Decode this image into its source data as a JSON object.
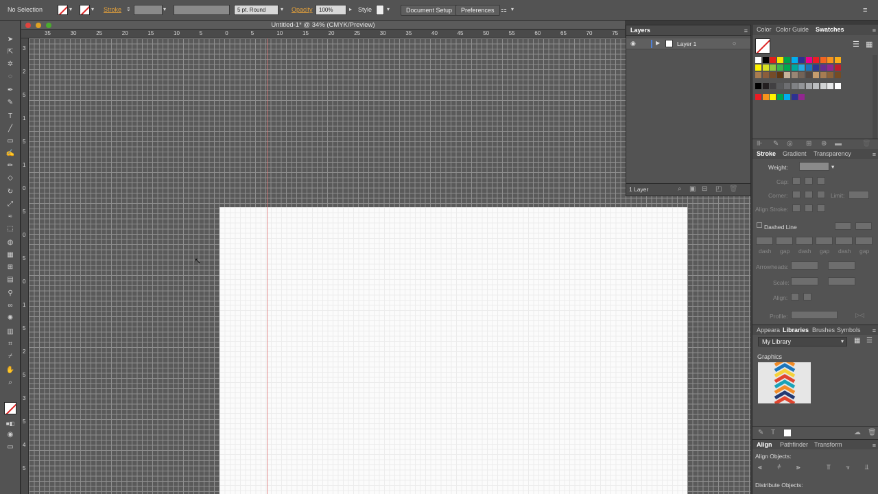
{
  "control_bar": {
    "selection": "No Selection",
    "stroke_label": "Stroke",
    "brush": "5 pt. Round",
    "opacity_label": "Opacity",
    "opacity_value": "100%",
    "style_label": "Style",
    "doc_setup": "Document Setup",
    "preferences": "Preferences"
  },
  "document": {
    "title": "Untitled-1* @ 34% (CMYK/Preview)",
    "ruler_ticks": [
      "35",
      "30",
      "25",
      "20",
      "15",
      "10",
      "5",
      "0",
      "5",
      "10",
      "15",
      "20",
      "25",
      "30",
      "35",
      "40",
      "45",
      "50",
      "55",
      "60",
      "65",
      "70",
      "75"
    ],
    "vruler_ticks": [
      "3",
      "2",
      "5",
      "1",
      "5",
      "1",
      "0",
      "5",
      "0",
      "5",
      "0",
      "1",
      "5",
      "2",
      "5",
      "3",
      "5",
      "4",
      "5"
    ]
  },
  "layers": {
    "tab": "Layers",
    "layer_name": "Layer 1",
    "count": "1 Layer"
  },
  "swatches": {
    "tabs": [
      "Color",
      "Color Guide",
      "Swatches"
    ],
    "row1": [
      "#ffffff",
      "#000000",
      "#e0201b",
      "#f5e500",
      "#00a14b",
      "#00aeef",
      "#2e3192",
      "#ec008c",
      "#ed1c24",
      "#f26522",
      "#f7941d",
      "#f9ad19"
    ],
    "row2": [
      "#fff200",
      "#d7df23",
      "#8dc63f",
      "#39b54a",
      "#00a651",
      "#00a99d",
      "#27aae1",
      "#1c75bc",
      "#2b3990",
      "#662d91",
      "#92278f",
      "#be1e2d"
    ],
    "row3": [
      "#a97c50",
      "#8b5e3c",
      "#754c29",
      "#603913",
      "#c7b299",
      "#998675",
      "#736357",
      "#534741",
      "#c69c6d",
      "#a67c52",
      "#8c6239",
      "#754c24"
    ],
    "row4": [
      "#000000",
      "#231f20",
      "#414042",
      "#58595b",
      "#6d6e71",
      "#808285",
      "#939598",
      "#a7a9ac",
      "#bcbec0",
      "#d1d3d4",
      "#e6e7e8",
      "#ffffff"
    ],
    "row5": [
      "#ed1c24",
      "#f7941d",
      "#fff200",
      "#00a651",
      "#00aeef",
      "#2e3192",
      "#92278f"
    ]
  },
  "stroke": {
    "tabs": [
      "Stroke",
      "Gradient",
      "Transparency"
    ],
    "weight": "Weight:",
    "cap": "Cap:",
    "corner": "Corner:",
    "limit": "Limit:",
    "align": "Align Stroke:",
    "dashed": "Dashed Line",
    "dash_labels": [
      "dash",
      "gap",
      "dash",
      "gap",
      "dash",
      "gap"
    ],
    "arrowheads": "Arrowheads:",
    "scale": "Scale:",
    "align2": "Align:",
    "profile": "Profile:"
  },
  "libraries": {
    "tabs": [
      "Appeara",
      "Libraries",
      "Brushes",
      "Symbols"
    ],
    "library": "My Library",
    "section": "Graphics"
  },
  "align": {
    "tabs": [
      "Align",
      "Pathfinder",
      "Transform"
    ],
    "align_objects": "Align Objects:",
    "distribute": "Distribute Objects:"
  }
}
